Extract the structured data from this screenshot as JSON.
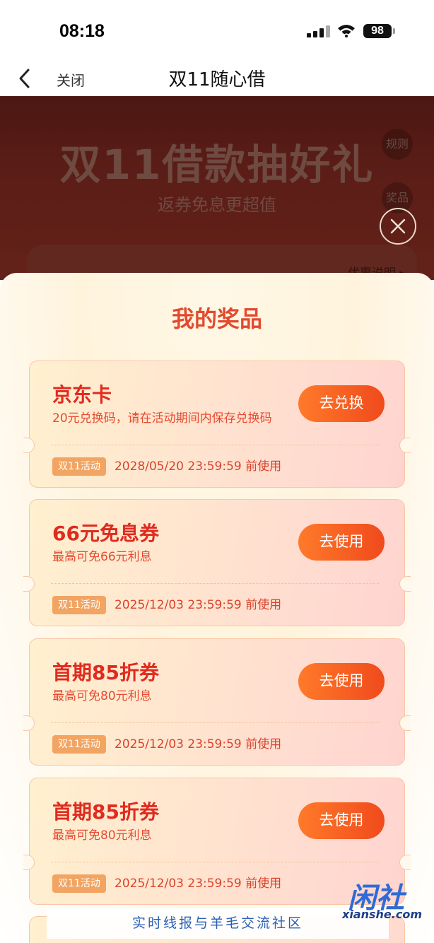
{
  "status_bar": {
    "time": "08:18",
    "battery": "98"
  },
  "nav": {
    "close_label": "关闭",
    "title": "双11随心借"
  },
  "banner": {
    "title": "双11借款抽好礼",
    "subtitle": "返券免息更超值",
    "rules_label": "规则",
    "prizes_label": "奖品",
    "offer_link": "优惠说明 ▸"
  },
  "sheet": {
    "title": "我的奖品",
    "prizes": [
      {
        "name": "京东卡",
        "desc": "20元兑换码，请在活动期间内保存兑换码",
        "button": "去兑换",
        "tag": "双11活动",
        "expiry": "2028/05/20 23:59:59 前使用"
      },
      {
        "name": "66元免息券",
        "desc": "最高可免66元利息",
        "button": "去使用",
        "tag": "双11活动",
        "expiry": "2025/12/03 23:59:59 前使用"
      },
      {
        "name": "首期85折券",
        "desc": "最高可免80元利息",
        "button": "去使用",
        "tag": "双11活动",
        "expiry": "2025/12/03 23:59:59 前使用"
      },
      {
        "name": "首期85折券",
        "desc": "最高可免80元利息",
        "button": "去使用",
        "tag": "双11活动",
        "expiry": "2025/12/03 23:59:59 前使用"
      }
    ]
  },
  "watermark": {
    "text": "实时线报与羊毛交流社区",
    "logo": "闲社",
    "url": "xianshe.com"
  }
}
